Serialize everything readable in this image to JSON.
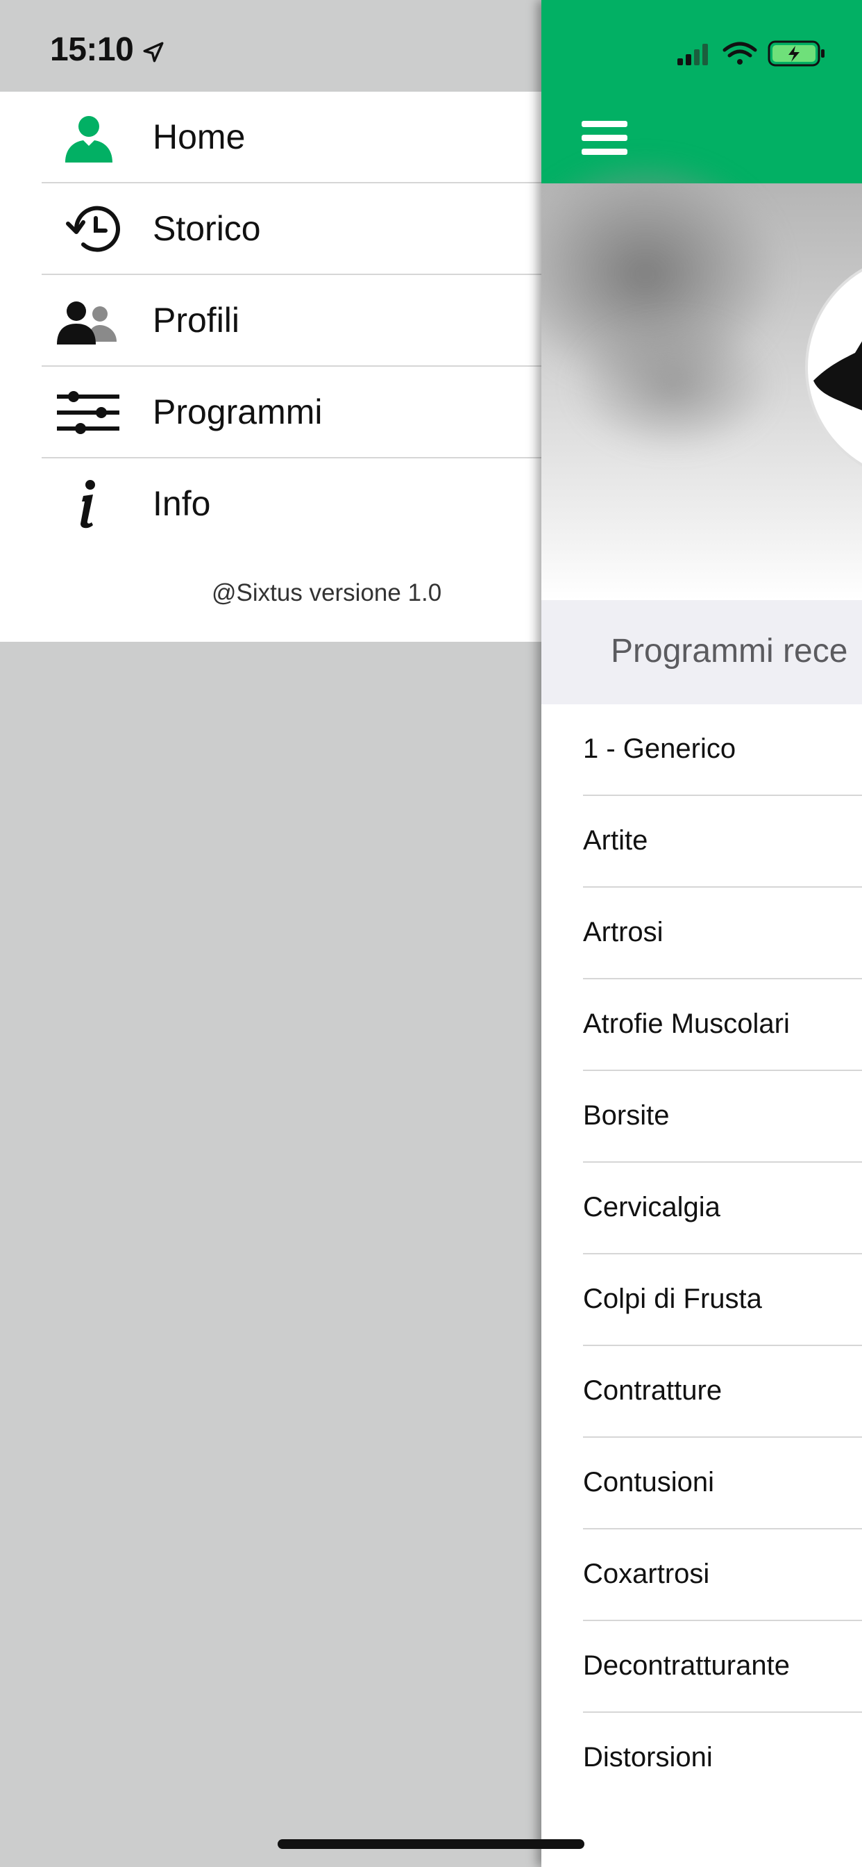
{
  "status_bar": {
    "time": "15:10"
  },
  "side_menu": {
    "items": [
      {
        "label": "Home",
        "icon": "user-icon",
        "color": "#02b064"
      },
      {
        "label": "Storico",
        "icon": "history-icon"
      },
      {
        "label": "Profili",
        "icon": "profiles-icon"
      },
      {
        "label": "Programmi",
        "icon": "sliders-icon"
      },
      {
        "label": "Info",
        "icon": "info-icon"
      }
    ],
    "version": "@Sixtus versione 1.0"
  },
  "main": {
    "section_header": "Programmi rece",
    "programs": [
      "1 - Generico",
      "Artite",
      "Artrosi",
      "Atrofie Muscolari",
      "Borsite",
      "Cervicalgia",
      "Colpi di Frusta",
      "Contratture",
      "Contusioni",
      "Coxartrosi",
      "Decontratturante",
      "Distorsioni"
    ]
  },
  "colors": {
    "accent": "#02b064",
    "overlay": "#cccdcd",
    "section_bg": "#efeff4"
  }
}
